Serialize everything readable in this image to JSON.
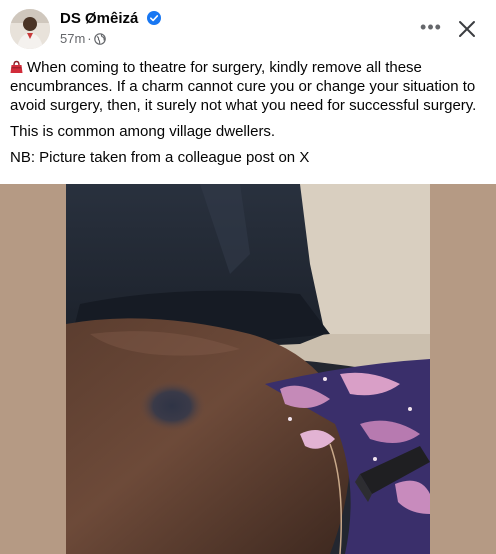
{
  "post": {
    "author": "DS Ømêizá",
    "time": "57m",
    "separator": "·",
    "more_label": "•••",
    "paragraphs": [
      "When coming to theatre for surgery, kindly remove all these encumbrances. If a charm cannot cure you or change your situation to avoid surgery, then, it surely not what you need for successful surgery.",
      "This is common among village dwellers.",
      "NB: Picture taken from a colleague post on X"
    ],
    "lead_icon": "handbag-emoji-icon",
    "audience_icon": "globe-icon"
  },
  "colors": {
    "text": "#050505",
    "meta": "#65676b",
    "verified": "#1877f2",
    "photo_frame": "#b79b85"
  }
}
